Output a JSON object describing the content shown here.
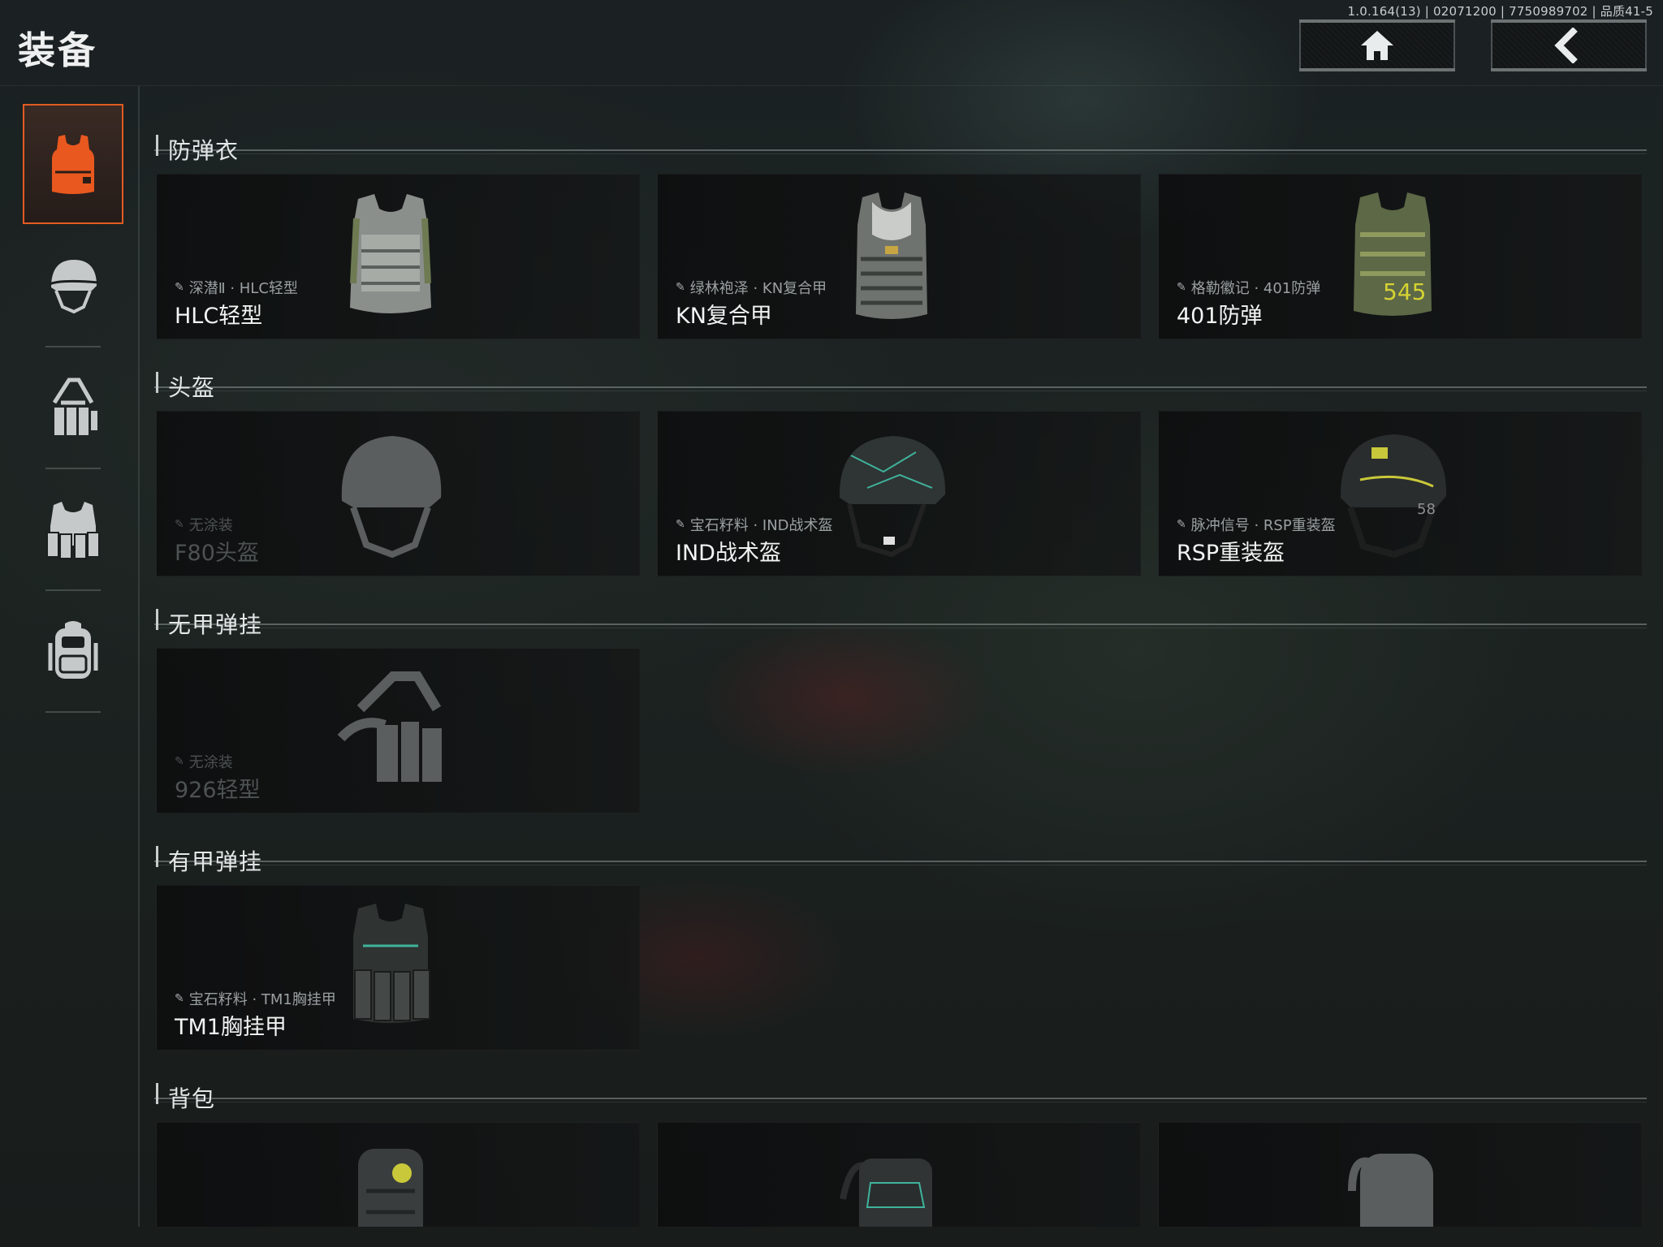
{
  "version_info": "1.0.164(13) | 02071200 | 7750989702 | 品质41-5",
  "header": {
    "title": "装备",
    "home_icon": "home-icon",
    "back_icon": "chevron-left-icon"
  },
  "colors": {
    "accent": "#e25b22",
    "background": "#1b2122",
    "card": "#121414"
  },
  "sidebar": {
    "items": [
      {
        "icon": "vest-icon",
        "active": true
      },
      {
        "icon": "helmet-icon",
        "active": false
      },
      {
        "icon": "chest-rig-icon",
        "active": false
      },
      {
        "icon": "armored-rig-icon",
        "active": false
      },
      {
        "icon": "backpack-icon",
        "active": false
      }
    ]
  },
  "sections": [
    {
      "title": "防弹衣",
      "cards": [
        {
          "skin": "深潜Ⅱ · HLC轻型",
          "name": "HLC轻型",
          "icon": "vest-icon"
        },
        {
          "skin": "绿林袍泽 · KN复合甲",
          "name": "KN复合甲",
          "icon": "vest-icon"
        },
        {
          "skin": "格勒徽记 · 401防弹",
          "name": "401防弹",
          "icon": "vest-icon"
        }
      ]
    },
    {
      "title": "头盔",
      "cards": [
        {
          "skin": "无涂装",
          "name": "F80头盔",
          "icon": "helmet-icon",
          "dim": true
        },
        {
          "skin": "宝石籽料 · IND战术盔",
          "name": "IND战术盔",
          "icon": "helmet-icon"
        },
        {
          "skin": "脉冲信号 · RSP重装盔",
          "name": "RSP重装盔",
          "icon": "helmet-icon"
        }
      ]
    },
    {
      "title": "无甲弹挂",
      "cards": [
        {
          "skin": "无涂装",
          "name": "926轻型",
          "icon": "chest-rig-icon",
          "dim": true
        }
      ]
    },
    {
      "title": "有甲弹挂",
      "cards": [
        {
          "skin": "宝石籽料 · TM1胸挂甲",
          "name": "TM1胸挂甲",
          "icon": "armored-rig-icon"
        }
      ]
    },
    {
      "title": "背包",
      "cards": [
        {
          "skin": "",
          "name": "",
          "icon": "backpack-icon"
        },
        {
          "skin": "",
          "name": "",
          "icon": "backpack-icon"
        },
        {
          "skin": "",
          "name": "",
          "icon": "backpack-icon",
          "dim": true
        }
      ]
    }
  ]
}
